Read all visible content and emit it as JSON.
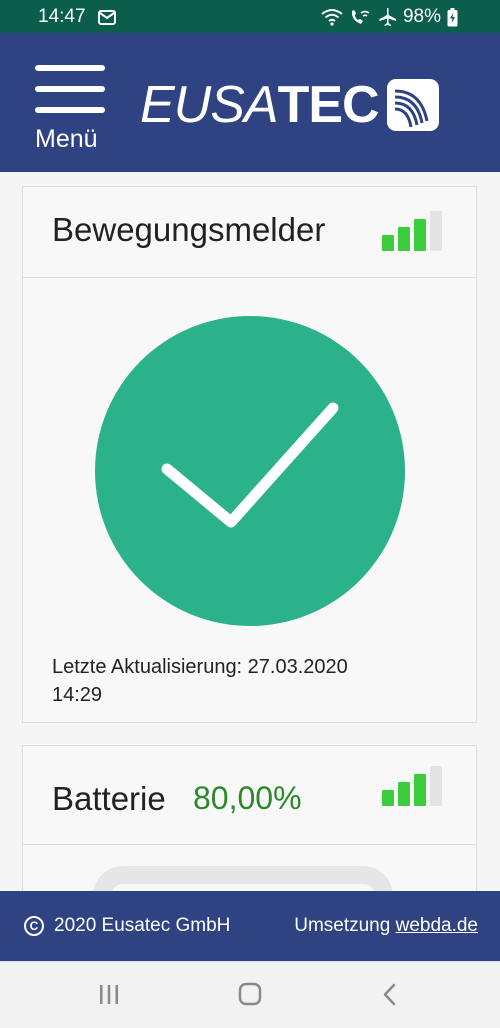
{
  "status_bar": {
    "time": "14:47",
    "battery_percent": "98%",
    "icons": [
      "mail-icon",
      "wifi-icon",
      "wifi-call-icon",
      "airplane-icon",
      "battery-charging-icon"
    ]
  },
  "header": {
    "menu_label": "Menü",
    "logo_text_italic": "EUSA",
    "logo_text_bold": "TEC",
    "colors": {
      "background": "#2f4282"
    }
  },
  "motion_card": {
    "title": "Bewegungsmelder",
    "signal_bars": 3,
    "signal_max": 4,
    "status": "ok",
    "status_icon": "checkmark-icon",
    "status_color": "#2bb28b",
    "update_label": "Letzte Aktualisierung: 27.03.2020",
    "update_time": "14:29"
  },
  "battery_card": {
    "title": "Batterie",
    "value": "80,00%",
    "value_color": "#2a8a2a",
    "signal_bars": 3,
    "signal_max": 4
  },
  "footer": {
    "copyright_text": "2020 Eusatec GmbH",
    "credit_prefix": "Umsetzung ",
    "credit_link": "webda.de"
  },
  "nav_bar": {
    "buttons": [
      "recent-apps-icon",
      "home-icon",
      "back-icon"
    ]
  }
}
